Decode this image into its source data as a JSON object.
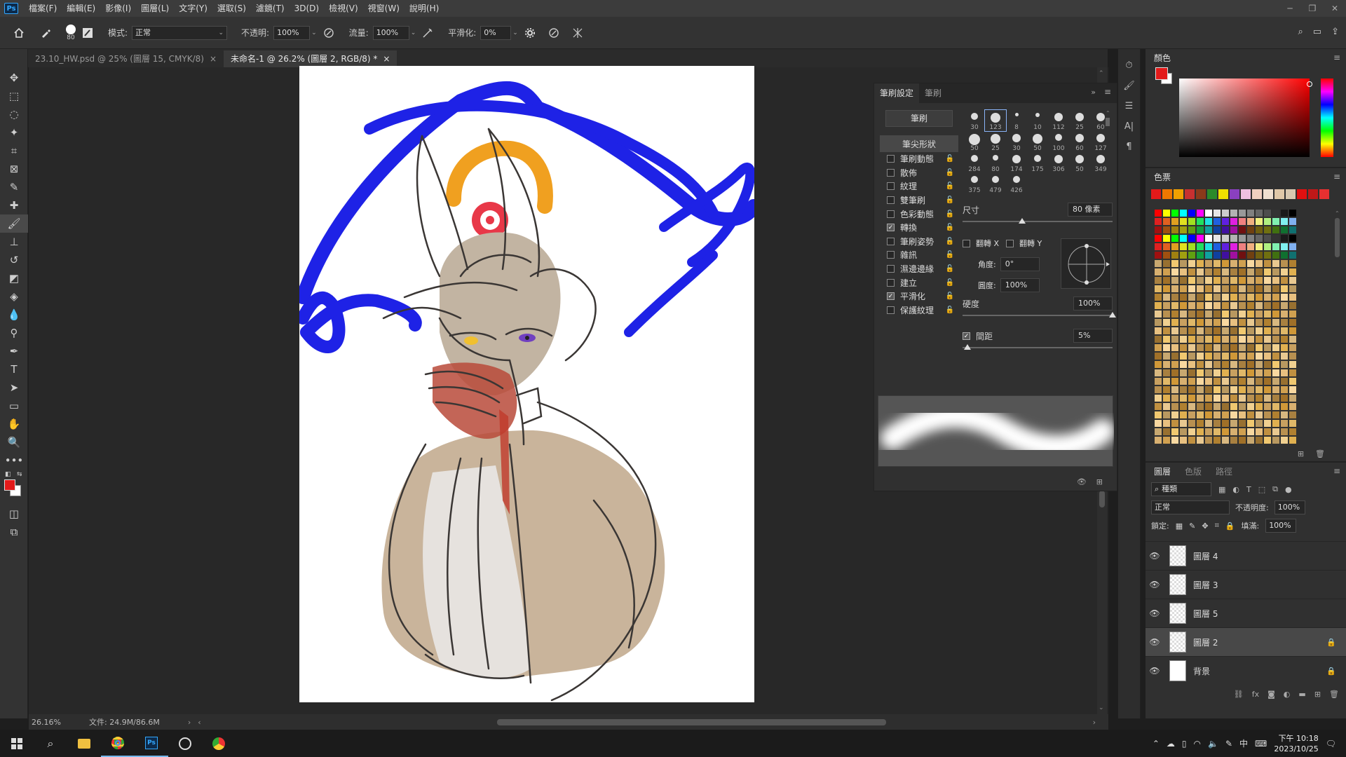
{
  "app": {
    "logo": "Ps",
    "window_controls": [
      "─",
      "❐",
      "✕"
    ]
  },
  "menu": [
    "檔案(F)",
    "編輯(E)",
    "影像(I)",
    "圖層(L)",
    "文字(Y)",
    "選取(S)",
    "濾鏡(T)",
    "3D(D)",
    "檢視(V)",
    "視窗(W)",
    "說明(H)"
  ],
  "options": {
    "brush_size": "80",
    "mode_label": "模式:",
    "mode_value": "正常",
    "opacity_label": "不透明:",
    "opacity_value": "100%",
    "flow_label": "流量:",
    "flow_value": "100%",
    "smoothing_label": "平滑化:",
    "smoothing_value": "0%"
  },
  "tabs": [
    {
      "label": "23.10_HW.psd @ 25% (圖層 15, CMYK/8)",
      "close": "×",
      "active": false
    },
    {
      "label": "未命名-1 @ 26.2% (圖層 2, RGB/8) *",
      "close": "×",
      "active": true
    }
  ],
  "status": {
    "zoom": "26.16%",
    "doc": "文件: 24.9M/86.6M"
  },
  "brush_panel": {
    "tabs": [
      "筆刷設定",
      "筆刷"
    ],
    "brush_button": "筆刷",
    "tip_shape": "筆尖形狀",
    "options": [
      {
        "label": "筆刷動態",
        "checked": false
      },
      {
        "label": "散佈",
        "checked": false
      },
      {
        "label": "紋理",
        "checked": false
      },
      {
        "label": "雙筆刷",
        "checked": false
      },
      {
        "label": "色彩動態",
        "checked": false
      },
      {
        "label": "轉換",
        "checked": true
      },
      {
        "label": "筆刷姿勢",
        "checked": false
      },
      {
        "label": "雜訊",
        "checked": false
      },
      {
        "label": "濕邊邊緣",
        "checked": false
      },
      {
        "label": "建立",
        "checked": false
      },
      {
        "label": "平滑化",
        "checked": true
      },
      {
        "label": "保護紋理",
        "checked": false
      }
    ],
    "tips": [
      "30",
      "123",
      "8",
      "10",
      "112",
      "25",
      "60",
      "50",
      "25",
      "30",
      "50",
      "100",
      "60",
      "127",
      "284",
      "80",
      "174",
      "175",
      "306",
      "50",
      "349",
      "375",
      "479",
      "426"
    ],
    "size_label": "尺寸",
    "size_value": "80 像素",
    "flip_x": "翻轉 X",
    "flip_y": "翻轉 Y",
    "angle_label": "角度:",
    "angle_value": "0°",
    "roundness_label": "圓度:",
    "roundness_value": "100%",
    "hardness_label": "硬度",
    "hardness_value": "100%",
    "spacing_label": "間距",
    "spacing_value": "5%"
  },
  "color_panel": {
    "title": "顏色",
    "foreground": "#e31a1a",
    "background": "#ffffff"
  },
  "swatch_panel": {
    "title": "色票",
    "top_row": [
      "#e31a1a",
      "#f07800",
      "#f0a000",
      "#c83030",
      "#8a3a1a",
      "#2a8a2a",
      "#f0e000",
      "#8a40c0",
      "#f0c0e0",
      "#f0d0c0",
      "#f0e0d0",
      "#e0c8a8",
      "#d8c8b0",
      "#e01010",
      "#c01818",
      "#e83030"
    ]
  },
  "layers_panel": {
    "tabs": [
      "圖層",
      "色版",
      "路徑"
    ],
    "filter_label": "種類",
    "blend_mode": "正常",
    "opacity_label": "不透明度:",
    "opacity_value": "100%",
    "lock_label": "鎖定:",
    "fill_label": "填滿:",
    "fill_value": "100%",
    "layers": [
      {
        "name": "圖層 4",
        "locked": false,
        "selected": false
      },
      {
        "name": "圖層 3",
        "locked": false,
        "selected": false
      },
      {
        "name": "圖層 5",
        "locked": false,
        "selected": false
      },
      {
        "name": "圖層 2",
        "locked": true,
        "selected": true
      },
      {
        "name": "背景",
        "locked": true,
        "selected": false
      }
    ]
  },
  "taskbar": {
    "time": "下午 10:18",
    "date": "2023/10/25",
    "ime": "中"
  }
}
